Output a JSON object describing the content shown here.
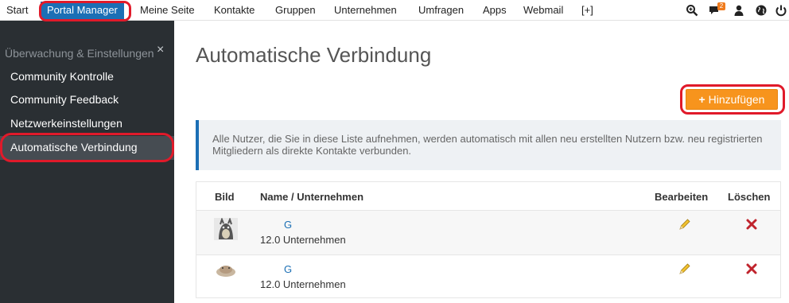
{
  "topnav": {
    "items": [
      "Start",
      "Portal Manager",
      "Meine Seite",
      "Kontakte",
      "Gruppen",
      "Unternehmen",
      "Umfragen",
      "Apps",
      "Webmail",
      "[+]"
    ],
    "active": "Portal Manager",
    "notification_count": "2"
  },
  "sidebar": {
    "close_label": "×",
    "section": "Überwachung & Einstellungen",
    "items": [
      "Community Kontrolle",
      "Community Feedback",
      "Netzwerkeinstellungen",
      "Automatische Verbindung"
    ],
    "active": "Automatische Verbindung"
  },
  "main": {
    "title": "Automatische Verbindung",
    "add_button": "Hinzufügen",
    "info_text": "Alle Nutzer, die Sie in diese Liste aufnehmen, werden automatisch mit allen neu erstellten Nutzern bzw. neu registrierten Mitgliedern als direkte Kontakte verbunden.",
    "table": {
      "headers": [
        "Bild",
        "Name / Unternehmen",
        "Bearbeiten",
        "Löschen"
      ],
      "rows": [
        {
          "name": "G",
          "company": "12.0 Unternehmen"
        },
        {
          "name": "G",
          "company": "12.0 Unternehmen"
        }
      ]
    }
  },
  "colors": {
    "accent": "#1b6fb5",
    "button": "#f7941d",
    "sidebar": "#2a2f33",
    "highlight": "#e01a2a"
  }
}
